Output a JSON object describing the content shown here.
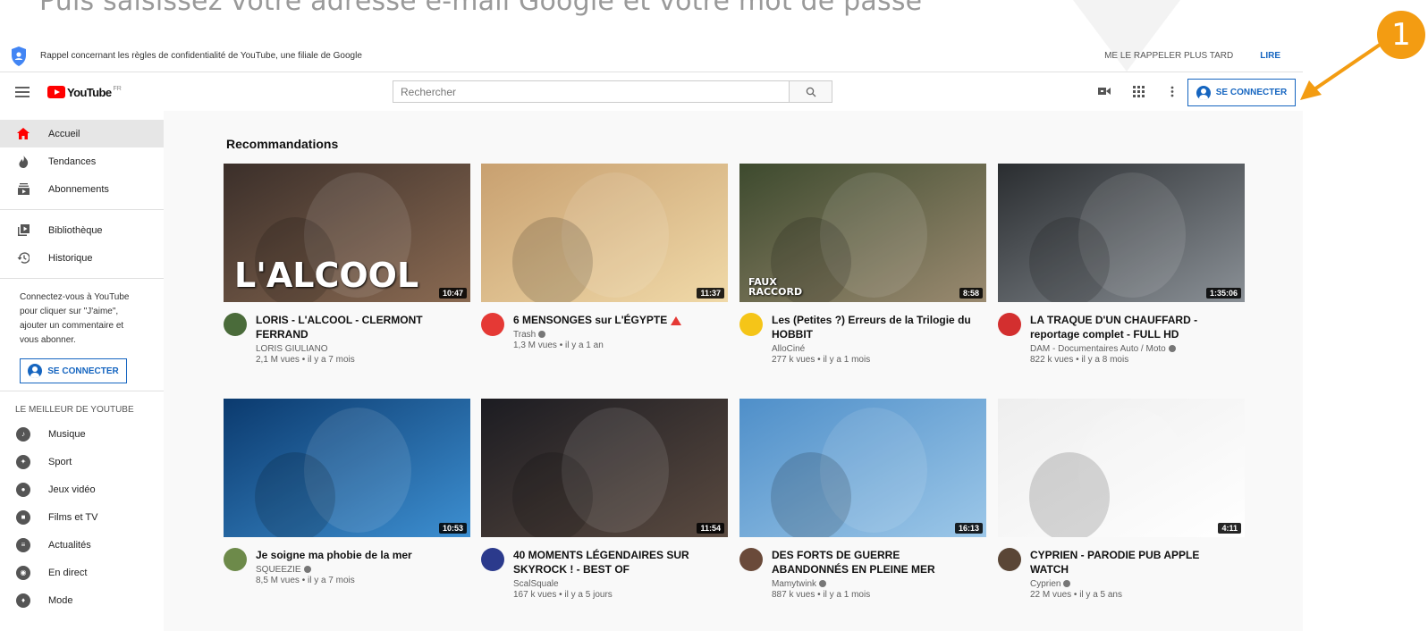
{
  "tutorial": {
    "caption": "Puis saisissez votre adresse e-mail Google et votre mot de passe",
    "step": "1",
    "accent_color": "#f39c12"
  },
  "banner": {
    "text": "Rappel concernant les règles de confidentialité de YouTube, une filiale de Google",
    "later_label": "ME LE RAPPELER PLUS TARD",
    "read_label": "LIRE"
  },
  "header": {
    "logo_text": "YouTube",
    "country": "FR",
    "search_placeholder": "Rechercher",
    "signin_label": "SE CONNECTER",
    "icons": [
      "video-camera-icon",
      "apps-grid-icon",
      "more-vertical-icon"
    ]
  },
  "sidebar": {
    "main": [
      {
        "label": "Accueil",
        "icon": "home-icon",
        "active": true
      },
      {
        "label": "Tendances",
        "icon": "flame-icon"
      },
      {
        "label": "Abonnements",
        "icon": "subscriptions-icon"
      }
    ],
    "library": [
      {
        "label": "Bibliothèque",
        "icon": "library-icon"
      },
      {
        "label": "Historique",
        "icon": "history-icon"
      }
    ],
    "signin_note": "Connectez-vous à YouTube pour cliquer sur \"J'aime\", ajouter un commentaire et vous abonner.",
    "signin_label": "SE CONNECTER",
    "best_heading": "LE MEILLEUR DE YOUTUBE",
    "best": [
      {
        "label": "Musique",
        "icon": "music-icon"
      },
      {
        "label": "Sport",
        "icon": "sport-icon"
      },
      {
        "label": "Jeux vidéo",
        "icon": "gaming-icon"
      },
      {
        "label": "Films et TV",
        "icon": "movies-icon"
      },
      {
        "label": "Actualités",
        "icon": "news-icon"
      },
      {
        "label": "En direct",
        "icon": "live-icon"
      },
      {
        "label": "Mode",
        "icon": "fashion-icon"
      }
    ]
  },
  "main": {
    "section_title": "Recommandations",
    "videos": [
      {
        "title": "LORIS - L'ALCOOL - CLERMONT FERRAND",
        "channel": "LORIS GIULIANO",
        "verified": false,
        "stats": "2,1 M vues • il y a 7 mois",
        "duration": "10:47",
        "thumb_text": "L'ALCOOL",
        "colors": [
          "#3b2f2a",
          "#8a6a52"
        ],
        "avatar_color": "#4a6b3a"
      },
      {
        "title": "6 MENSONGES sur L'ÉGYPTE",
        "channel": "Trash",
        "verified": true,
        "warn": true,
        "stats": "1,3 M vues • il y a 1 an",
        "duration": "11:37",
        "thumb_text": "",
        "colors": [
          "#c8a070",
          "#f0d9a8"
        ],
        "avatar_color": "#e53935"
      },
      {
        "title": "Les (Petites ?) Erreurs de la Trilogie du HOBBIT",
        "channel": "AlloCiné",
        "verified": false,
        "stats": "277 k vues • il y a 1 mois",
        "duration": "8:58",
        "thumb_text": "FAUX RACCORD",
        "colors": [
          "#3d4a2e",
          "#9a8a70"
        ],
        "avatar_color": "#f5c518"
      },
      {
        "title": "LA TRAQUE D'UN CHAUFFARD - reportage complet - FULL HD",
        "channel": "DAM - Documentaires Auto / Moto",
        "verified": true,
        "stats": "822 k vues • il y a 8 mois",
        "duration": "1:35:06",
        "thumb_text": "",
        "colors": [
          "#2a2d30",
          "#8a9096"
        ],
        "avatar_color": "#d32f2f"
      },
      {
        "title": "Je soigne ma phobie de la mer",
        "channel": "SQUEEZIE",
        "verified": true,
        "stats": "8,5 M vues • il y a 7 mois",
        "duration": "10:53",
        "thumb_text": "",
        "colors": [
          "#0b3a6e",
          "#3d8fd1"
        ],
        "avatar_color": "#6d8a4a"
      },
      {
        "title": "40 MOMENTS LÉGENDAIRES SUR SKYROCK ! - BEST OF",
        "channel": "ScalSquale",
        "verified": false,
        "stats": "167 k vues • il y a 5 jours",
        "duration": "11:54",
        "thumb_text": "",
        "colors": [
          "#1c1c22",
          "#5a4a40"
        ],
        "avatar_color": "#2b3a8c"
      },
      {
        "title": "DES FORTS DE GUERRE ABANDONNÉS EN PLEINE MER",
        "channel": "Mamytwink",
        "verified": true,
        "stats": "887 k vues • il y a 1 mois",
        "duration": "16:13",
        "thumb_text": "",
        "colors": [
          "#4f8fc9",
          "#9cc7e8"
        ],
        "avatar_color": "#6a4a3a"
      },
      {
        "title": "CYPRIEN - PARODIE PUB APPLE WATCH",
        "channel": "Cyprien",
        "verified": true,
        "stats": "22 M vues • il y a 5 ans",
        "duration": "4:11",
        "thumb_text": "",
        "colors": [
          "#eeeeee",
          "#ffffff"
        ],
        "avatar_color": "#5a4636"
      }
    ]
  }
}
